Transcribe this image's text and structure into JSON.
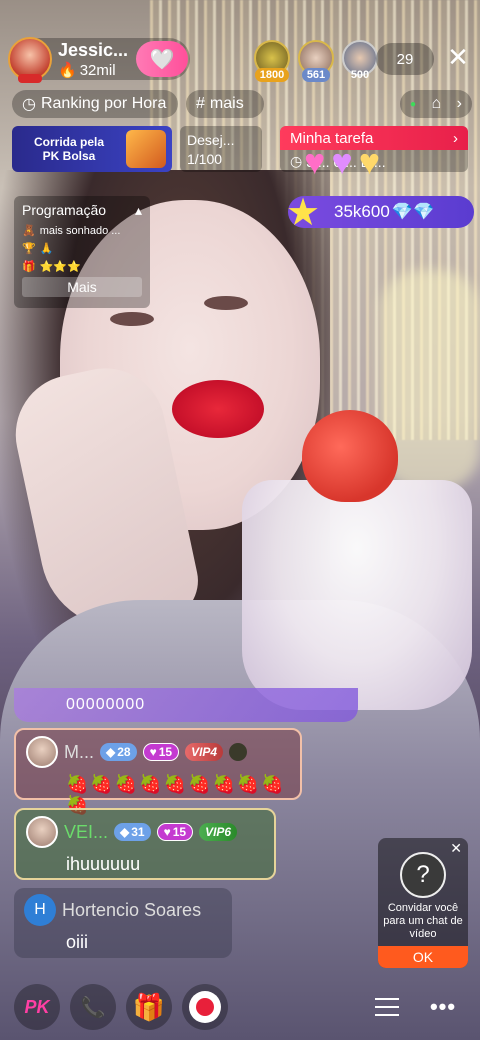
{
  "host": {
    "name": "Jessic...",
    "fans": "32mil",
    "follow_icon": "heart-wings-icon"
  },
  "viewers": [
    {
      "score": "1800"
    },
    {
      "score": "561"
    },
    {
      "score": "500"
    }
  ],
  "viewer_count": "29",
  "close_label": "✕",
  "ranking": {
    "label": "Ranking por Hora"
  },
  "tags": {
    "label": "mais"
  },
  "pk_card": {
    "label": "Corrida pela PK Bolsa"
  },
  "wish": {
    "title": "Desej...",
    "progress": "1/100"
  },
  "task": {
    "title": "Minha tarefa",
    "body": "3 ... 0 ... Di..."
  },
  "coins": {
    "value": "35k600"
  },
  "schedule": {
    "title": "Programação",
    "rows": [
      "mais sonhado ...",
      "",
      ""
    ],
    "more_label": "Mais"
  },
  "typing_text": "00000000",
  "chat": [
    {
      "name": "M...",
      "level": "28",
      "fan_level": "15",
      "vip": "VIP4",
      "text": "🍓🍓🍓🍓🍓🍓🍓🍓🍓🍓"
    },
    {
      "name": "VEI...",
      "level": "31",
      "fan_level": "15",
      "vip": "VIP6",
      "text": "ihuuuuuu"
    },
    {
      "name": "Hortencio Soares",
      "avatar_letter": "H",
      "text": "oiii"
    }
  ],
  "invite": {
    "text": "Convidar você para um chat de vídeo",
    "ok_label": "OK"
  },
  "bottom": {
    "pk_label": "PK"
  },
  "colors": {
    "accent_pink": "#ff4f9a",
    "task_red": "#e8204a",
    "coin_purple": "#5a3cd0",
    "invite_orange": "#ff5a1e"
  }
}
